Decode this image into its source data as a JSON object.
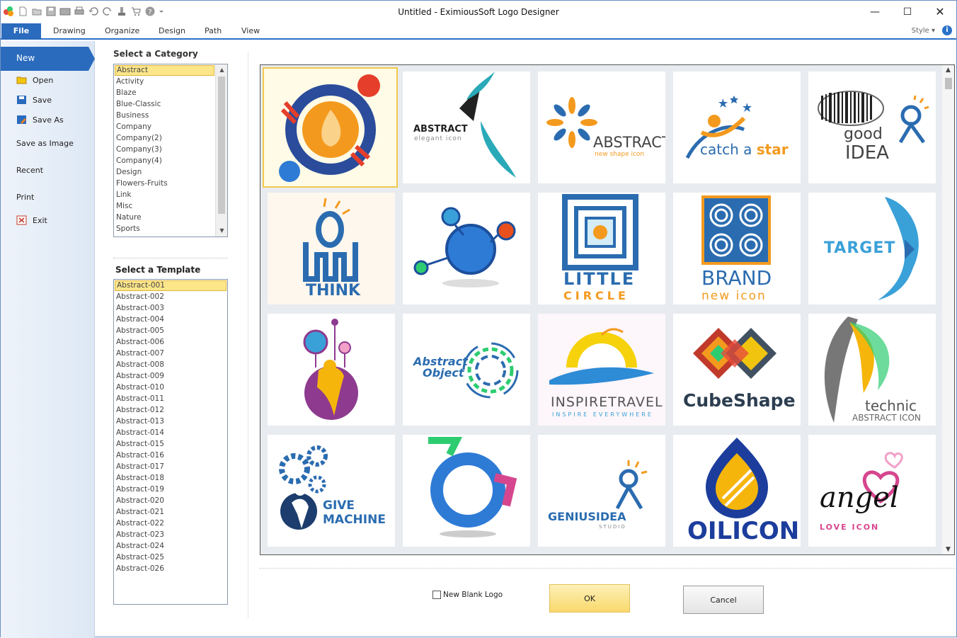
{
  "window": {
    "title": "Untitled - EximiousSoft Logo Designer",
    "controls": [
      "minimize-icon",
      "maximize-icon",
      "close-icon"
    ]
  },
  "qat_icons": [
    "app-logo-icon",
    "new-icon",
    "open-icon",
    "save-icon",
    "save-all-icon",
    "print-icon",
    "undo-icon",
    "redo-icon",
    "paint-icon",
    "cart-icon",
    "help-icon",
    "dropdown-icon"
  ],
  "ribbon": {
    "tabs": [
      "File",
      "Drawing",
      "Organize",
      "Design",
      "Path",
      "View"
    ],
    "style_label": "Style ▾"
  },
  "backstage": {
    "items": [
      "New",
      "Open",
      "Save",
      "Save As",
      "Save as Image",
      "Recent",
      "Print",
      "Exit"
    ]
  },
  "category": {
    "label": "Select a Category",
    "items": [
      "Abstract",
      "Activity",
      "Blaze",
      "Blue-Classic",
      "Business",
      "Company",
      "Company(2)",
      "Company(3)",
      "Company(4)",
      "Design",
      "Flowers-Fruits",
      "Link",
      "Misc",
      "Nature",
      "Sports"
    ],
    "selected": "Abstract"
  },
  "template": {
    "label": "Select a Template",
    "items": [
      "Abstract-001",
      "Abstract-002",
      "Abstract-003",
      "Abstract-004",
      "Abstract-005",
      "Abstract-006",
      "Abstract-007",
      "Abstract-008",
      "Abstract-009",
      "Abstract-010",
      "Abstract-011",
      "Abstract-012",
      "Abstract-013",
      "Abstract-014",
      "Abstract-015",
      "Abstract-016",
      "Abstract-017",
      "Abstract-018",
      "Abstract-019",
      "Abstract-020",
      "Abstract-021",
      "Abstract-022",
      "Abstract-023",
      "Abstract-024",
      "Abstract-025",
      "Abstract-026"
    ],
    "selected": "Abstract-001"
  },
  "gallery": {
    "tiles": [
      {
        "id": "tile-1",
        "texts": []
      },
      {
        "id": "tile-2",
        "texts": [
          "ABSTRACT",
          "elegant icon"
        ]
      },
      {
        "id": "tile-3",
        "texts": [
          "ABSTRACT",
          "new shape icon"
        ]
      },
      {
        "id": "tile-4",
        "texts": [
          "catch a ",
          "star"
        ]
      },
      {
        "id": "tile-5",
        "texts": [
          "good",
          "IDEA"
        ]
      },
      {
        "id": "tile-6",
        "texts": [
          "THINK"
        ]
      },
      {
        "id": "tile-7",
        "texts": []
      },
      {
        "id": "tile-8",
        "texts": [
          "LITTLE",
          "CIRCLE"
        ]
      },
      {
        "id": "tile-9",
        "texts": [
          "BRAND",
          "new icon"
        ]
      },
      {
        "id": "tile-10",
        "texts": [
          "TARGET"
        ]
      },
      {
        "id": "tile-11",
        "texts": []
      },
      {
        "id": "tile-12",
        "texts": [
          "Abstract",
          "Object"
        ]
      },
      {
        "id": "tile-13",
        "texts": [
          "INSPIRETRAVEL",
          "INSPIRE EVERYWHERE"
        ]
      },
      {
        "id": "tile-14",
        "texts": [
          "CubeShape"
        ]
      },
      {
        "id": "tile-15",
        "texts": [
          "technic",
          "ABSTRACT ICON"
        ]
      },
      {
        "id": "tile-16",
        "texts": [
          "GIVE",
          "MACHINE"
        ]
      },
      {
        "id": "tile-17",
        "texts": []
      },
      {
        "id": "tile-18",
        "texts": [
          "GENIUSIDEA",
          "STUDIO"
        ]
      },
      {
        "id": "tile-19",
        "texts": [
          "OILICON"
        ]
      },
      {
        "id": "tile-20",
        "texts": [
          "angel",
          "LOVE ICON"
        ]
      }
    ],
    "selected_index": 0
  },
  "footer": {
    "checkbox_label": "New Blank Logo",
    "checkbox_checked": false,
    "ok_label": "OK",
    "cancel_label": "Cancel"
  },
  "colors": {
    "accent": "#2a6bbd",
    "selection": "#fde68a"
  }
}
